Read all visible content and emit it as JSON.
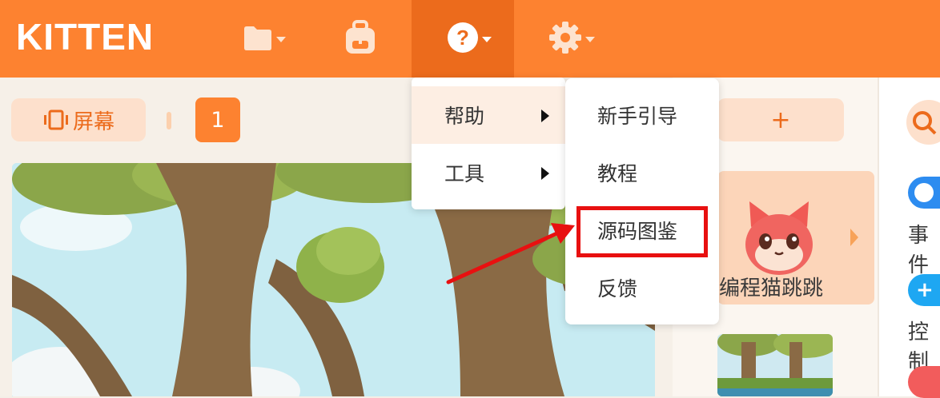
{
  "app": {
    "logo_text": "KITTEN",
    "brand_color": "#fd8230"
  },
  "toolbar": {
    "icons": [
      "folder-icon",
      "backpack-icon",
      "help-icon",
      "gear-icon"
    ],
    "screen_button_label": "屏幕",
    "page_number": "1",
    "add_label": "+"
  },
  "help_menu": {
    "items": [
      {
        "label": "帮助",
        "active": true
      },
      {
        "label": "工具",
        "active": false
      }
    ]
  },
  "help_submenu": {
    "items": [
      {
        "label": "新手引导"
      },
      {
        "label": "教程"
      },
      {
        "label": "源码图鉴"
      },
      {
        "label": "反馈"
      }
    ]
  },
  "sprites": {
    "selected_name": "编程猫跳跳"
  },
  "categories": {
    "items": [
      {
        "label": "事件"
      },
      {
        "label": "控制"
      }
    ]
  },
  "annotation": {
    "highlight_color": "#e81010"
  }
}
